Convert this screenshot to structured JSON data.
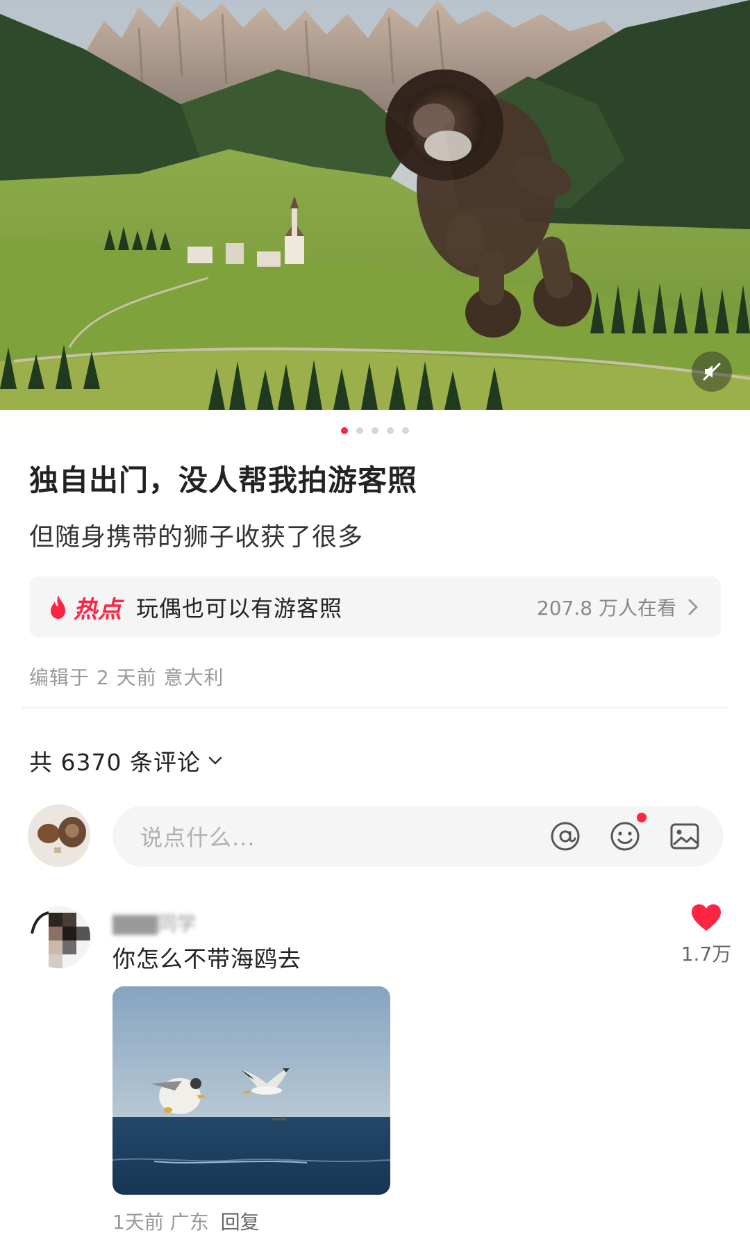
{
  "hero": {
    "image_alt": "",
    "carousel": {
      "total": 5,
      "active_index": 0
    }
  },
  "post": {
    "title": "独自出门，没人帮我拍游客照",
    "description": "但随身携带的狮子收获了很多"
  },
  "hot_topic": {
    "badge": "热点",
    "topic": "玩偶也可以有游客照",
    "views": "207.8 万人在看"
  },
  "meta": {
    "edited": "编辑于 2 天前 意大利"
  },
  "comments": {
    "count_label": "共 6370 条评论",
    "input_placeholder": "说点什么...",
    "items": [
      {
        "username": "▇▇▇同学",
        "text": "你怎么不带海鸥去",
        "likes": "1.7万",
        "meta_time_location": "1天前 广东",
        "reply_label": "回复"
      }
    ]
  },
  "colors": {
    "accent": "#ff2442",
    "muted_text": "#999999",
    "card_bg": "#f5f5f5"
  }
}
